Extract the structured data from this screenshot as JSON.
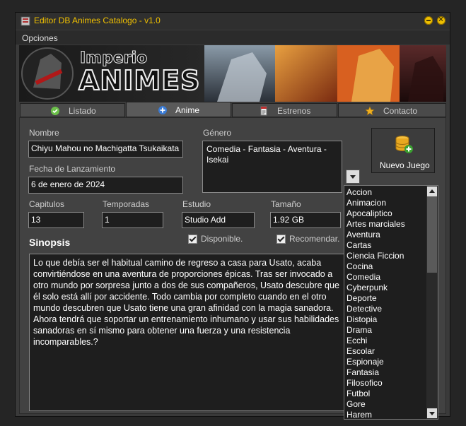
{
  "window": {
    "title": "Editor DB Animes Catalogo  - v1.0"
  },
  "menu": {
    "options_label": "Opciones"
  },
  "banner": {
    "logo_top": "Imperio",
    "logo_bottom": "ANIMES"
  },
  "tabs": [
    {
      "label": "Listado",
      "icon": "check-circle-icon",
      "color": "#6cc04a"
    },
    {
      "label": "Anime",
      "icon": "plus-circle-icon",
      "color": "#3a7bd5"
    },
    {
      "label": "Estrenos",
      "icon": "document-icon",
      "color": "#c03030"
    },
    {
      "label": "Contacto",
      "icon": "star-icon",
      "color": "#f0b020"
    }
  ],
  "form": {
    "nombre_label": "Nombre",
    "nombre_value": "Chiyu Mahou no Machigatta Tsukaikata",
    "fecha_label": "Fecha de Lanzamiento",
    "fecha_value": "6 de enero de 2024",
    "genero_label": "Género",
    "genero_value": "Comedia - Fantasia - Aventura - Isekai",
    "capitulos_label": "Capitulos",
    "capitulos_value": "13",
    "temporadas_label": "Temporadas",
    "temporadas_value": "1",
    "estudio_label": "Estudio",
    "estudio_value": "Studio Add",
    "tamano_label": "Tamaño",
    "tamano_value": "1.92 GB",
    "disponible_label": "Disponible.",
    "recomendar_label": "Recomendar.",
    "sinopsis_label": "Sinopsis",
    "sinopsis_value": "Lo que debía ser el habitual camino de regreso a casa para Usato, acaba convirtiéndose en una aventura de proporciones épicas. Tras ser invocado a otro mundo por sorpresa junto a dos de sus compañeros, Usato descubre que él solo está allí por accidente. Todo cambia por completo cuando en el otro mundo descubren que Usato tiene una gran afinidad con la magia sanadora. Ahora tendrá que soportar un entrenamiento inhumano y usar sus habilidades sanadoras en sí mismo para obtener una fuerza y una resistencia incomparables.?"
  },
  "new_button": {
    "label": "Nuevo Juego"
  },
  "genre_list": [
    "Accion",
    "Animacion",
    "Apocaliptico",
    "Artes marciales",
    "Aventura",
    "Cartas",
    "Ciencia Ficcion",
    "Cocina",
    "Comedia",
    "Cyberpunk",
    "Deporte",
    "Detective",
    "Distopia",
    "Drama",
    "Ecchi",
    "Escolar",
    "Espionaje",
    "Fantasia",
    "Filosofico",
    "Futbol",
    "Gore",
    "Harem"
  ]
}
